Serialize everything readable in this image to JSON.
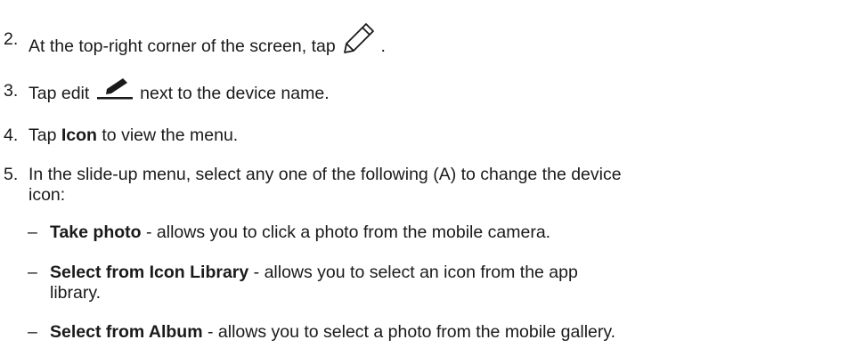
{
  "steps": [
    {
      "number": "2.",
      "text_before_icon": "At the top-right corner of the screen, tap",
      "icon": "pencil-outline-icon",
      "text_after_icon": "."
    },
    {
      "number": "3.",
      "text_before_icon": "Tap edit",
      "icon": "edit-pen-underline-icon",
      "text_after_icon": "next to the device name."
    },
    {
      "number": "4.",
      "text_before_bold": "Tap",
      "bold": "Icon",
      "text_after_bold": "to view the menu."
    },
    {
      "number": "5.",
      "line1": "In the slide-up menu, select any one of the following (A) to change the device",
      "line2": "icon:"
    }
  ],
  "options": [
    {
      "dash": "–",
      "title": "Take photo",
      "desc": "- allows you to click a photo from the mobile camera."
    },
    {
      "dash": "–",
      "title": "Select from Icon Library",
      "desc_line1": "- allows you to select an icon from the app",
      "desc_line2": "library."
    },
    {
      "dash": "–",
      "title": "Select from Album",
      "desc": "- allows you to select a photo from the mobile gallery."
    }
  ]
}
